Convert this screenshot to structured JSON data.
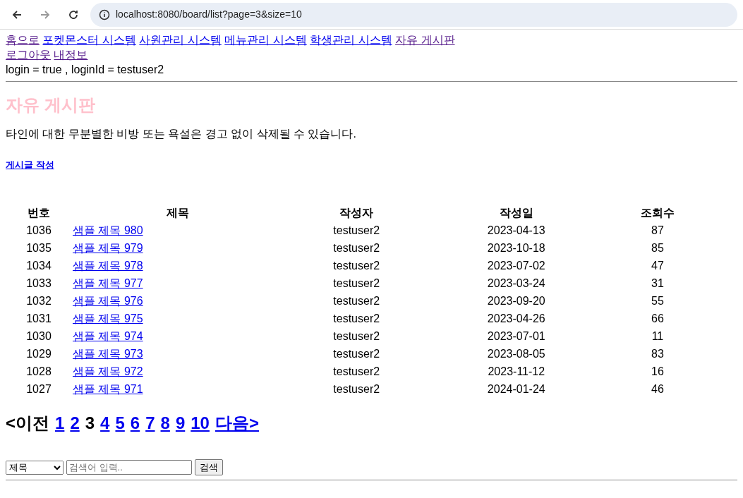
{
  "browser": {
    "url": "localhost:8080/board/list?page=3&size=10"
  },
  "nav": [
    {
      "label": "홈으로",
      "visited": true
    },
    {
      "label": "포켓몬스터 시스템",
      "visited": false
    },
    {
      "label": "사원관리 시스템",
      "visited": false
    },
    {
      "label": "메뉴관리 시스템",
      "visited": false
    },
    {
      "label": "학생관리 시스템",
      "visited": false
    },
    {
      "label": "자유 게시판",
      "visited": true
    }
  ],
  "nav2": [
    {
      "label": "로그아웃",
      "visited": true
    },
    {
      "label": "내정보",
      "visited": true
    }
  ],
  "login_status": "login = true , loginId = testuser2",
  "title": "자유 게시판",
  "notice": "타인에 대한 무분별한 비방 또는 욕설은 경고 없이 삭제될 수 있습니다.",
  "write_link": "게시글 작성",
  "table": {
    "columns": [
      "번호",
      "제목",
      "작성자",
      "작성일",
      "조회수"
    ],
    "rows": [
      [
        "1036",
        "샘플 제목 980",
        "testuser2",
        "2023-04-13",
        "87"
      ],
      [
        "1035",
        "샘플 제목 979",
        "testuser2",
        "2023-10-18",
        "85"
      ],
      [
        "1034",
        "샘플 제목 978",
        "testuser2",
        "2023-07-02",
        "47"
      ],
      [
        "1033",
        "샘플 제목 977",
        "testuser2",
        "2023-03-24",
        "31"
      ],
      [
        "1032",
        "샘플 제목 976",
        "testuser2",
        "2023-09-20",
        "55"
      ],
      [
        "1031",
        "샘플 제목 975",
        "testuser2",
        "2023-04-26",
        "66"
      ],
      [
        "1030",
        "샘플 제목 974",
        "testuser2",
        "2023-07-01",
        "11"
      ],
      [
        "1029",
        "샘플 제목 973",
        "testuser2",
        "2023-08-05",
        "83"
      ],
      [
        "1028",
        "샘플 제목 972",
        "testuser2",
        "2023-11-12",
        "16"
      ],
      [
        "1027",
        "샘플 제목 971",
        "testuser2",
        "2024-01-24",
        "46"
      ]
    ]
  },
  "pagination": {
    "prev": "<이전",
    "next": "다음>",
    "pages": [
      {
        "label": "1",
        "selected": false
      },
      {
        "label": "2",
        "selected": false
      },
      {
        "label": "3",
        "selected": true
      },
      {
        "label": "4",
        "selected": false
      },
      {
        "label": "5",
        "selected": false
      },
      {
        "label": "6",
        "selected": false
      },
      {
        "label": "7",
        "selected": false
      },
      {
        "label": "8",
        "selected": false
      },
      {
        "label": "9",
        "selected": false
      },
      {
        "label": "10",
        "selected": false
      }
    ]
  },
  "search": {
    "select_value": "제목",
    "placeholder": "검색어 입력..",
    "button": "검색"
  }
}
